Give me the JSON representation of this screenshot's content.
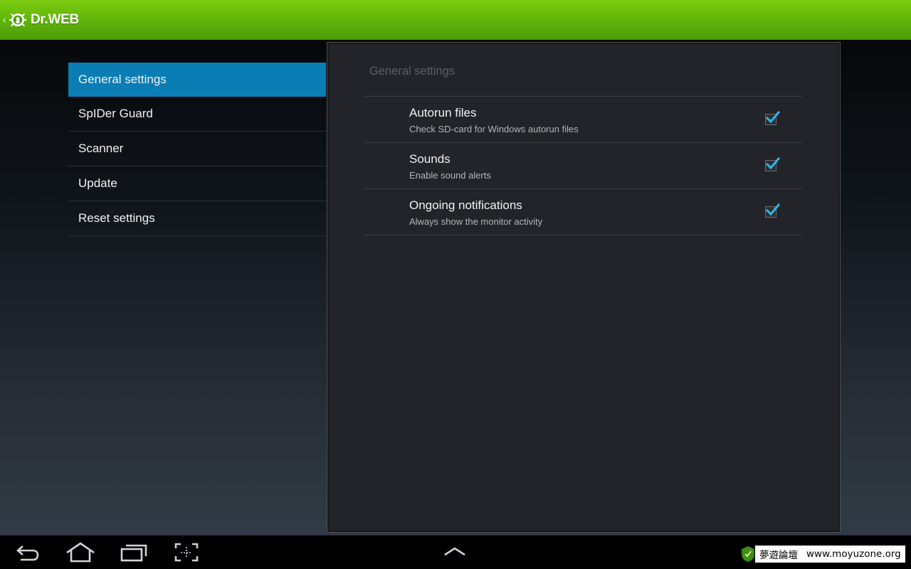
{
  "action_bar": {
    "up_caret": "‹",
    "app_name": "Dr.WEB",
    "brand_color": "#63b70a"
  },
  "nav": {
    "items": [
      {
        "label": "General settings",
        "selected": true
      },
      {
        "label": "SpIDer Guard",
        "selected": false
      },
      {
        "label": "Scanner",
        "selected": false
      },
      {
        "label": "Update",
        "selected": false
      },
      {
        "label": "Reset settings",
        "selected": false
      }
    ],
    "selected_color": "#0a7db4"
  },
  "panel": {
    "title": "General settings",
    "prefs": [
      {
        "title": "Autorun files",
        "summary": "Check SD-card for Windows autorun files",
        "checked": true
      },
      {
        "title": "Sounds",
        "summary": "Enable sound alerts",
        "checked": true
      },
      {
        "title": "Ongoing notifications",
        "summary": "Always show the monitor activity",
        "checked": true
      }
    ],
    "check_color": "#33b5e5"
  },
  "system_bar": {
    "buttons": [
      "back-icon",
      "home-icon",
      "recent-apps-icon",
      "screenshot-icon",
      "chevron-up-icon"
    ]
  },
  "watermark": {
    "cn_text": "夢遊論壇",
    "url": "www.moyuzone.org"
  }
}
